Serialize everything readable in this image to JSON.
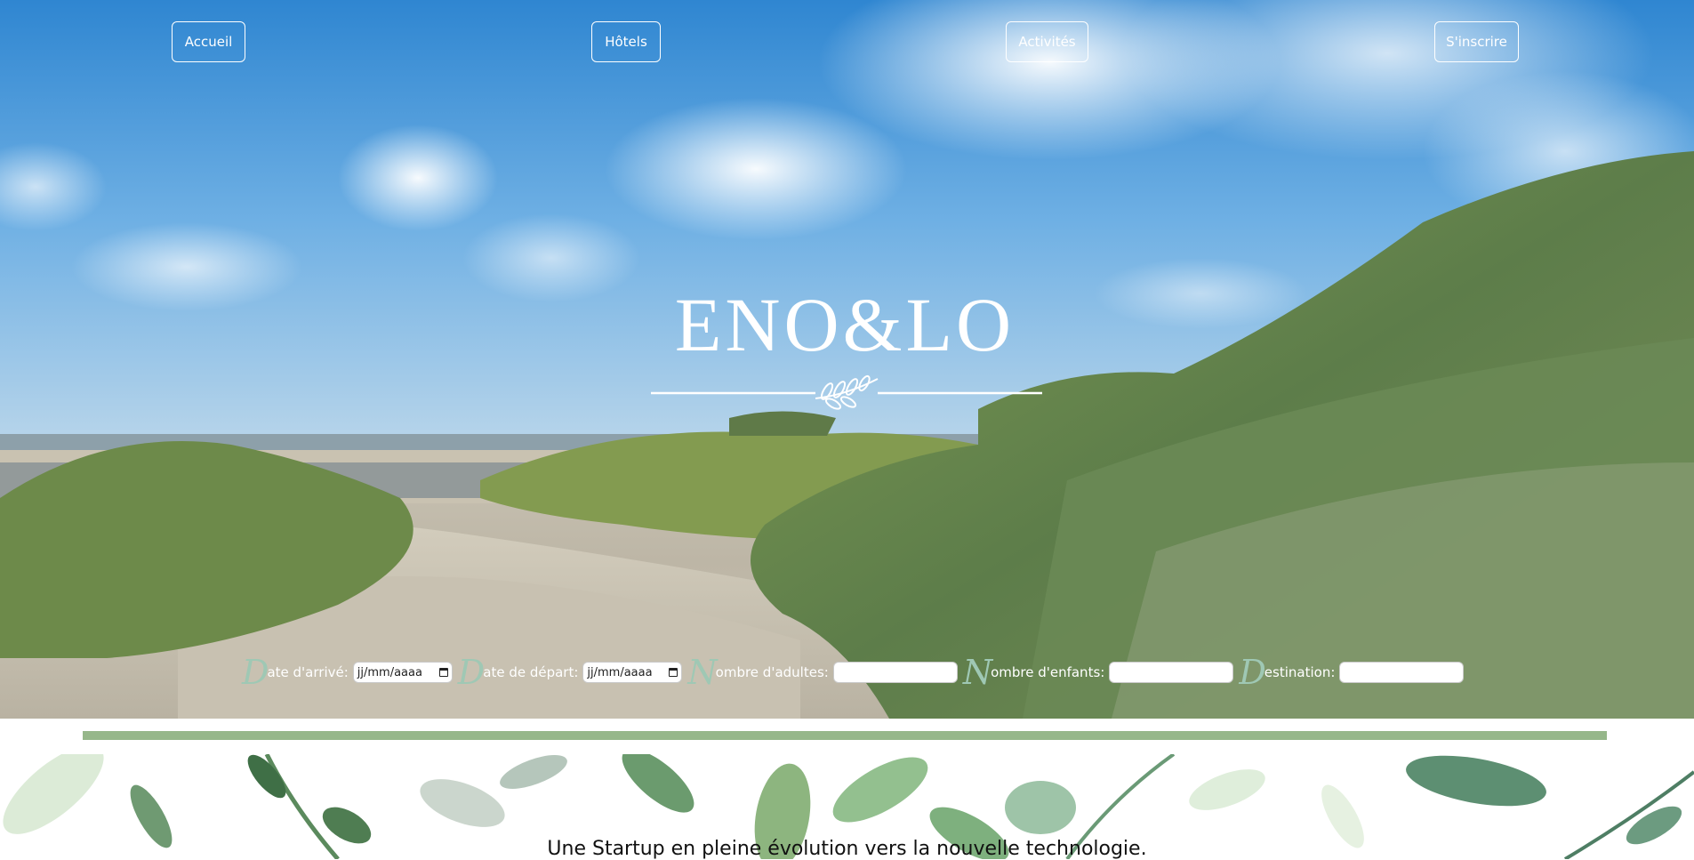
{
  "nav": {
    "home": "Accueil",
    "hotels": "Hôtels",
    "activities": "Activités",
    "signup": "S'inscrire"
  },
  "brand": {
    "name": "ENO&LO",
    "ornament": "leaf-ornament-icon"
  },
  "search": {
    "arrival": {
      "initial": "D",
      "label": "ate d'arrivé:",
      "placeholder": "jj/mm/aaaa"
    },
    "departure": {
      "initial": "D",
      "label": "ate de départ:",
      "placeholder": "jj/mm/aaaa"
    },
    "adults": {
      "initial": "N",
      "label": "ombre d'adultes:",
      "value": ""
    },
    "children": {
      "initial": "N",
      "label": "ombre d'enfants:",
      "value": ""
    },
    "destination": {
      "initial": "D",
      "label": "estination:",
      "value": ""
    }
  },
  "section": {
    "tagline": "Une Startup en pleine évolution vers la nouvelle technologie."
  },
  "colors": {
    "accent_green": "#96b78a",
    "initial_color": "#9fc8b4",
    "nav_border": "#ffffff"
  }
}
